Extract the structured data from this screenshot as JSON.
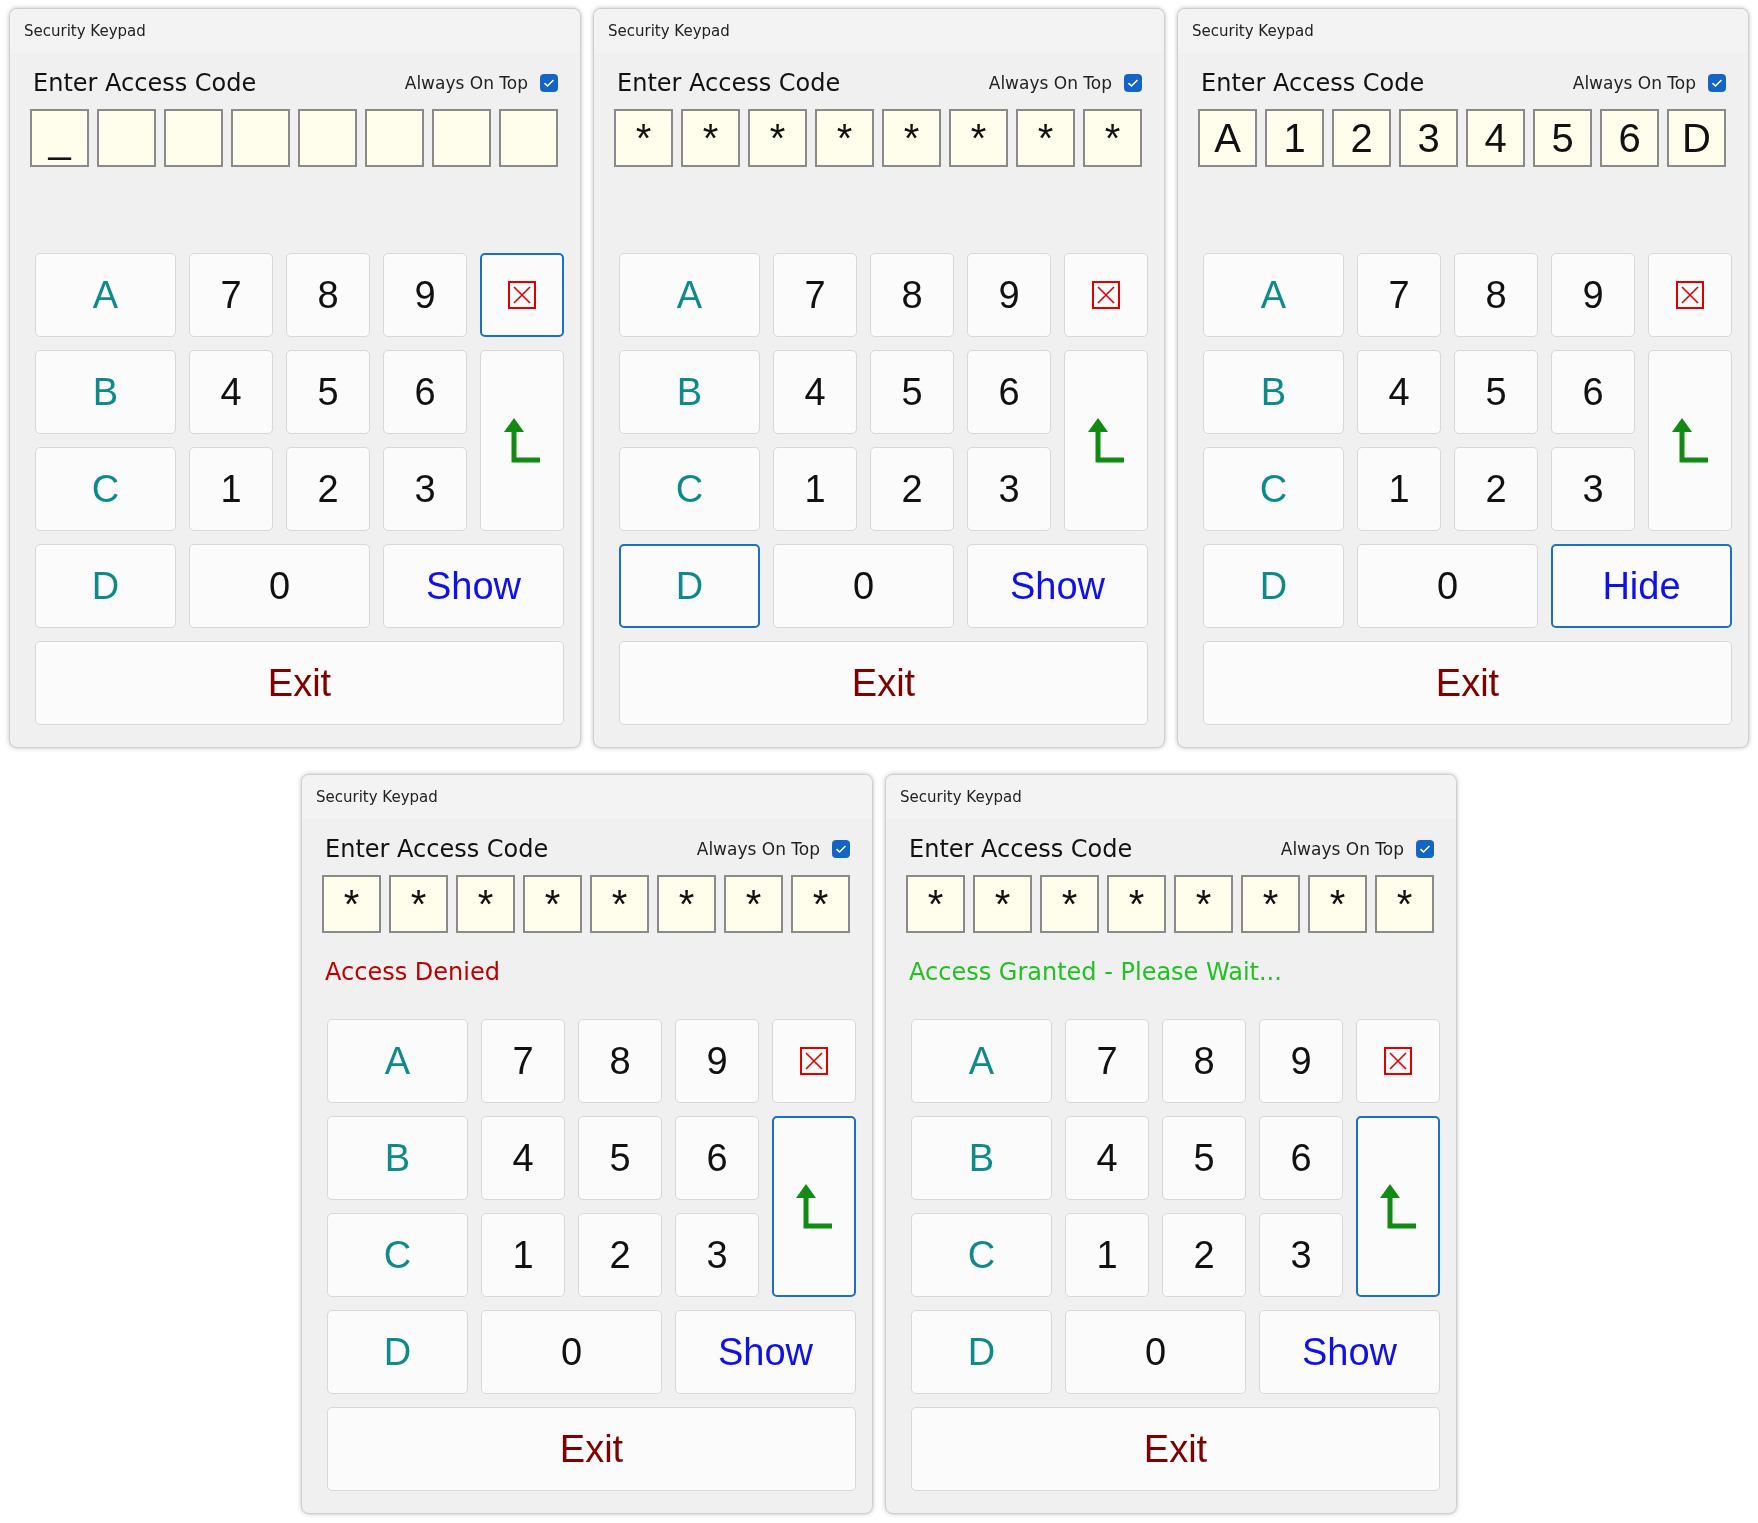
{
  "windows": [
    {
      "title": "Security Keypad",
      "heading": "Enter Access Code",
      "always_on_top": {
        "label": "Always On Top",
        "checked": true
      },
      "cells": [
        {
          "text": "_"
        },
        {},
        {},
        {},
        {},
        {},
        {},
        {}
      ],
      "keys": [
        {
          "kind": "letter",
          "label": "A",
          "focused": false
        },
        {
          "kind": "digit",
          "label": "7",
          "focused": false
        },
        {
          "kind": "digit",
          "label": "8",
          "focused": false
        },
        {
          "kind": "digit",
          "label": "9",
          "focused": false
        },
        {
          "kind": "clear",
          "focused": true
        },
        {
          "kind": "letter",
          "label": "B",
          "focused": false
        },
        {
          "kind": "digit",
          "label": "4",
          "focused": false
        },
        {
          "kind": "digit",
          "label": "5",
          "focused": false
        },
        {
          "kind": "digit",
          "label": "6",
          "focused": false
        },
        {
          "kind": "enter",
          "focused": false
        },
        {
          "kind": "letter",
          "label": "C",
          "focused": false
        },
        {
          "kind": "digit",
          "label": "1",
          "focused": false
        },
        {
          "kind": "digit",
          "label": "2",
          "focused": false
        },
        {
          "kind": "digit",
          "label": "3",
          "focused": false
        },
        {
          "kind": "letter",
          "label": "D",
          "focused": false
        },
        {
          "kind": "zero",
          "label": "0",
          "focused": false
        },
        {
          "kind": "toggle",
          "label": "Show",
          "focused": false
        },
        {
          "kind": "exit",
          "label": "Exit",
          "focused": false
        }
      ]
    },
    {
      "title": "Security Keypad",
      "heading": "Enter Access Code",
      "always_on_top": {
        "label": "Always On Top",
        "checked": true
      },
      "cells": [
        {
          "text": "*"
        },
        {
          "text": "*"
        },
        {
          "text": "*"
        },
        {
          "text": "*"
        },
        {
          "text": "*"
        },
        {
          "text": "*"
        },
        {
          "text": "*"
        },
        {
          "text": "*"
        }
      ],
      "keys": [
        {
          "kind": "letter",
          "label": "A",
          "focused": false
        },
        {
          "kind": "digit",
          "label": "7",
          "focused": false
        },
        {
          "kind": "digit",
          "label": "8",
          "focused": false
        },
        {
          "kind": "digit",
          "label": "9",
          "focused": false
        },
        {
          "kind": "clear",
          "focused": false
        },
        {
          "kind": "letter",
          "label": "B",
          "focused": false
        },
        {
          "kind": "digit",
          "label": "4",
          "focused": false
        },
        {
          "kind": "digit",
          "label": "5",
          "focused": false
        },
        {
          "kind": "digit",
          "label": "6",
          "focused": false
        },
        {
          "kind": "enter",
          "focused": false
        },
        {
          "kind": "letter",
          "label": "C",
          "focused": false
        },
        {
          "kind": "digit",
          "label": "1",
          "focused": false
        },
        {
          "kind": "digit",
          "label": "2",
          "focused": false
        },
        {
          "kind": "digit",
          "label": "3",
          "focused": false
        },
        {
          "kind": "letter",
          "label": "D",
          "focused": true
        },
        {
          "kind": "zero",
          "label": "0",
          "focused": false
        },
        {
          "kind": "toggle",
          "label": "Show",
          "focused": false
        },
        {
          "kind": "exit",
          "label": "Exit",
          "focused": false
        }
      ]
    },
    {
      "title": "Security Keypad",
      "heading": "Enter Access Code",
      "always_on_top": {
        "label": "Always On Top",
        "checked": true
      },
      "cells": [
        {
          "text": "A"
        },
        {
          "text": "1"
        },
        {
          "text": "2"
        },
        {
          "text": "3"
        },
        {
          "text": "4"
        },
        {
          "text": "5"
        },
        {
          "text": "6"
        },
        {
          "text": "D"
        }
      ],
      "keys": [
        {
          "kind": "letter",
          "label": "A",
          "focused": false
        },
        {
          "kind": "digit",
          "label": "7",
          "focused": false
        },
        {
          "kind": "digit",
          "label": "8",
          "focused": false
        },
        {
          "kind": "digit",
          "label": "9",
          "focused": false
        },
        {
          "kind": "clear",
          "focused": false
        },
        {
          "kind": "letter",
          "label": "B",
          "focused": false
        },
        {
          "kind": "digit",
          "label": "4",
          "focused": false
        },
        {
          "kind": "digit",
          "label": "5",
          "focused": false
        },
        {
          "kind": "digit",
          "label": "6",
          "focused": false
        },
        {
          "kind": "enter",
          "focused": false
        },
        {
          "kind": "letter",
          "label": "C",
          "focused": false
        },
        {
          "kind": "digit",
          "label": "1",
          "focused": false
        },
        {
          "kind": "digit",
          "label": "2",
          "focused": false
        },
        {
          "kind": "digit",
          "label": "3",
          "focused": false
        },
        {
          "kind": "letter",
          "label": "D",
          "focused": false
        },
        {
          "kind": "zero",
          "label": "0",
          "focused": false
        },
        {
          "kind": "toggle",
          "label": "Hide",
          "focused": true
        },
        {
          "kind": "exit",
          "label": "Exit",
          "focused": false
        }
      ]
    },
    {
      "title": "Security Keypad",
      "heading": "Enter Access Code",
      "always_on_top": {
        "label": "Always On Top",
        "checked": true
      },
      "cells": [
        {
          "text": "*"
        },
        {
          "text": "*"
        },
        {
          "text": "*"
        },
        {
          "text": "*"
        },
        {
          "text": "*"
        },
        {
          "text": "*"
        },
        {
          "text": "*"
        },
        {
          "text": "*"
        }
      ],
      "status": {
        "kind": "denied",
        "text": "Access Denied"
      },
      "keys": [
        {
          "kind": "letter",
          "label": "A",
          "focused": false
        },
        {
          "kind": "digit",
          "label": "7",
          "focused": false
        },
        {
          "kind": "digit",
          "label": "8",
          "focused": false
        },
        {
          "kind": "digit",
          "label": "9",
          "focused": false
        },
        {
          "kind": "clear",
          "focused": false
        },
        {
          "kind": "letter",
          "label": "B",
          "focused": false
        },
        {
          "kind": "digit",
          "label": "4",
          "focused": false
        },
        {
          "kind": "digit",
          "label": "5",
          "focused": false
        },
        {
          "kind": "digit",
          "label": "6",
          "focused": false
        },
        {
          "kind": "enter",
          "focused": true
        },
        {
          "kind": "letter",
          "label": "C",
          "focused": false
        },
        {
          "kind": "digit",
          "label": "1",
          "focused": false
        },
        {
          "kind": "digit",
          "label": "2",
          "focused": false
        },
        {
          "kind": "digit",
          "label": "3",
          "focused": false
        },
        {
          "kind": "letter",
          "label": "D",
          "focused": false
        },
        {
          "kind": "zero",
          "label": "0",
          "focused": false
        },
        {
          "kind": "toggle",
          "label": "Show",
          "focused": false
        },
        {
          "kind": "exit",
          "label": "Exit",
          "focused": false
        }
      ]
    },
    {
      "title": "Security Keypad",
      "heading": "Enter Access Code",
      "always_on_top": {
        "label": "Always On Top",
        "checked": true
      },
      "cells": [
        {
          "text": "*"
        },
        {
          "text": "*"
        },
        {
          "text": "*"
        },
        {
          "text": "*"
        },
        {
          "text": "*"
        },
        {
          "text": "*"
        },
        {
          "text": "*"
        },
        {
          "text": "*"
        }
      ],
      "status": {
        "kind": "granted",
        "text": "Access Granted - Please Wait..."
      },
      "keys": [
        {
          "kind": "letter",
          "label": "A",
          "focused": false
        },
        {
          "kind": "digit",
          "label": "7",
          "focused": false
        },
        {
          "kind": "digit",
          "label": "8",
          "focused": false
        },
        {
          "kind": "digit",
          "label": "9",
          "focused": false
        },
        {
          "kind": "clear",
          "focused": false
        },
        {
          "kind": "letter",
          "label": "B",
          "focused": false
        },
        {
          "kind": "digit",
          "label": "4",
          "focused": false
        },
        {
          "kind": "digit",
          "label": "5",
          "focused": false
        },
        {
          "kind": "digit",
          "label": "6",
          "focused": false
        },
        {
          "kind": "enter",
          "focused": true
        },
        {
          "kind": "letter",
          "label": "C",
          "focused": false
        },
        {
          "kind": "digit",
          "label": "1",
          "focused": false
        },
        {
          "kind": "digit",
          "label": "2",
          "focused": false
        },
        {
          "kind": "digit",
          "label": "3",
          "focused": false
        },
        {
          "kind": "letter",
          "label": "D",
          "focused": false
        },
        {
          "kind": "zero",
          "label": "0",
          "focused": false
        },
        {
          "kind": "toggle",
          "label": "Show",
          "focused": false
        },
        {
          "kind": "exit",
          "label": "Exit",
          "focused": false
        }
      ]
    }
  ]
}
